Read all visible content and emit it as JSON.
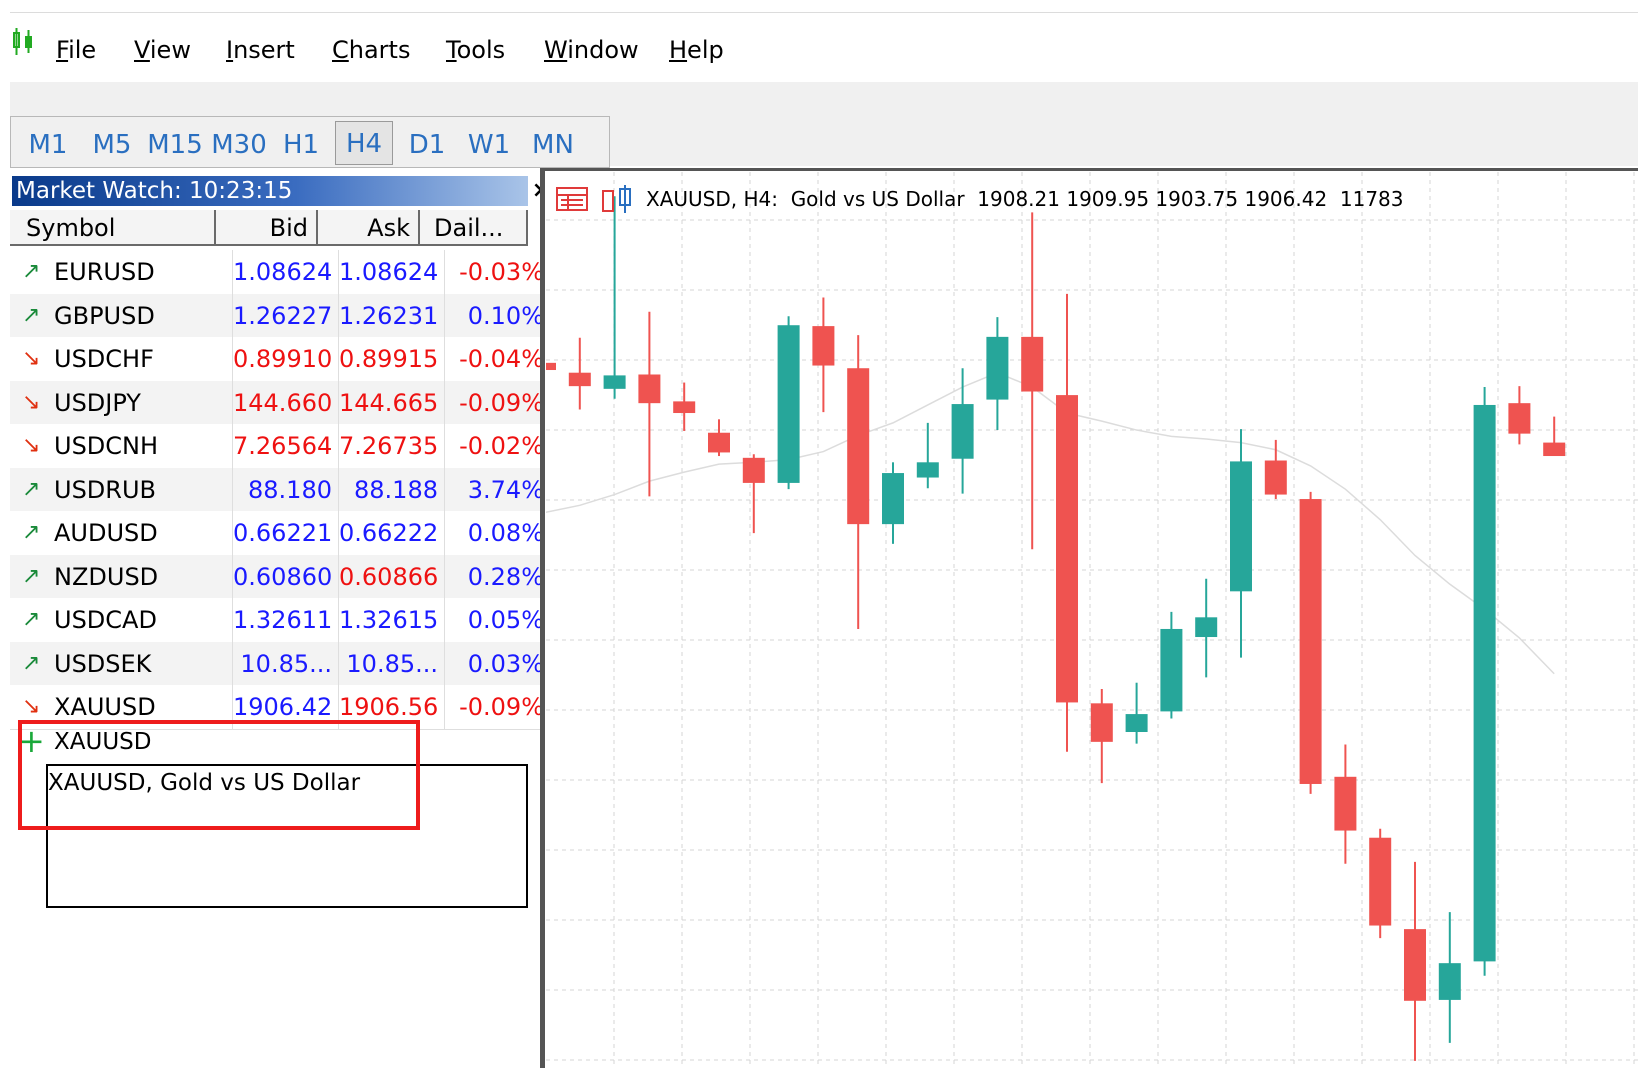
{
  "menu": {
    "items": [
      {
        "label": "File",
        "key": "F"
      },
      {
        "label": "View",
        "key": "V"
      },
      {
        "label": "Insert",
        "key": "I"
      },
      {
        "label": "Charts",
        "key": "C"
      },
      {
        "label": "Tools",
        "key": "T"
      },
      {
        "label": "Window",
        "key": "W"
      },
      {
        "label": "Help",
        "key": "H"
      }
    ]
  },
  "timeframes": [
    "M1",
    "M5",
    "M15",
    "M30",
    "H1",
    "H4",
    "D1",
    "W1",
    "MN"
  ],
  "active_timeframe": "H4",
  "market_watch": {
    "title": "Market Watch: 10:23:15",
    "close_label": "×",
    "columns": [
      "Symbol",
      "Bid",
      "Ask",
      "Dail..."
    ],
    "rows": [
      {
        "symbol": "EURUSD",
        "bid": "1.08624",
        "ask": "1.08624",
        "daily": "-0.03%",
        "dir": "up",
        "bid_color": "blue",
        "ask_color": "blue",
        "daily_color": "red"
      },
      {
        "symbol": "GBPUSD",
        "bid": "1.26227",
        "ask": "1.26231",
        "daily": "0.10%",
        "dir": "up",
        "bid_color": "blue",
        "ask_color": "blue",
        "daily_color": "blue"
      },
      {
        "symbol": "USDCHF",
        "bid": "0.89910",
        "ask": "0.89915",
        "daily": "-0.04%",
        "dir": "down",
        "bid_color": "red",
        "ask_color": "red",
        "daily_color": "red"
      },
      {
        "symbol": "USDJPY",
        "bid": "144.660",
        "ask": "144.665",
        "daily": "-0.09%",
        "dir": "down",
        "bid_color": "red",
        "ask_color": "red",
        "daily_color": "red"
      },
      {
        "symbol": "USDCNH",
        "bid": "7.26564",
        "ask": "7.26735",
        "daily": "-0.02%",
        "dir": "down",
        "bid_color": "red",
        "ask_color": "red",
        "daily_color": "red"
      },
      {
        "symbol": "USDRUB",
        "bid": "88.180",
        "ask": "88.188",
        "daily": "3.74%",
        "dir": "up",
        "bid_color": "blue",
        "ask_color": "blue",
        "daily_color": "blue"
      },
      {
        "symbol": "AUDUSD",
        "bid": "0.66221",
        "ask": "0.66222",
        "daily": "0.08%",
        "dir": "up",
        "bid_color": "blue",
        "ask_color": "blue",
        "daily_color": "blue"
      },
      {
        "symbol": "NZDUSD",
        "bid": "0.60860",
        "ask": "0.60866",
        "daily": "0.28%",
        "dir": "up",
        "bid_color": "blue",
        "ask_color": "red",
        "daily_color": "blue"
      },
      {
        "symbol": "USDCAD",
        "bid": "1.32611",
        "ask": "1.32615",
        "daily": "0.05%",
        "dir": "up",
        "bid_color": "blue",
        "ask_color": "blue",
        "daily_color": "blue"
      },
      {
        "symbol": "USDSEK",
        "bid": "10.85...",
        "ask": "10.85...",
        "daily": "0.03%",
        "dir": "up",
        "bid_color": "blue",
        "ask_color": "blue",
        "daily_color": "blue"
      },
      {
        "symbol": "XAUUSD",
        "bid": "1906.42",
        "ask": "1906.56",
        "daily": "-0.09%",
        "dir": "down",
        "bid_color": "blue",
        "ask_color": "red",
        "daily_color": "red"
      }
    ],
    "add_symbol": {
      "value": "XAUUSD",
      "suggestion": "XAUUSD, Gold vs US Dollar"
    }
  },
  "chart": {
    "title": "XAUUSD, H4:  Gold vs US Dollar  1908.21 1909.95 1903.75 1906.42  11783",
    "colors": {
      "bull": "#26a69a",
      "bear": "#ef5350",
      "grid": "#d4d4d4",
      "ma": "#dcdcdc"
    }
  },
  "chart_data": {
    "type": "candlestick",
    "title": "XAUUSD, H4:  Gold vs US Dollar  1908.21 1909.95 1903.75 1906.42  11783",
    "candles": [
      {
        "dir": "bear",
        "open": 0.787,
        "close": 0.779,
        "high": 0.787,
        "low": 0.779
      },
      {
        "dir": "bear",
        "open": 0.776,
        "close": 0.761,
        "high": 0.815,
        "low": 0.735
      },
      {
        "dir": "bull",
        "open": 0.758,
        "close": 0.773,
        "high": 0.973,
        "low": 0.747
      },
      {
        "dir": "bear",
        "open": 0.774,
        "close": 0.742,
        "high": 0.844,
        "low": 0.638
      },
      {
        "dir": "bear",
        "open": 0.744,
        "close": 0.731,
        "high": 0.765,
        "low": 0.711
      },
      {
        "dir": "bear",
        "open": 0.709,
        "close": 0.687,
        "high": 0.724,
        "low": 0.683
      },
      {
        "dir": "bear",
        "open": 0.681,
        "close": 0.653,
        "high": 0.685,
        "low": 0.597
      },
      {
        "dir": "bull",
        "open": 0.653,
        "close": 0.829,
        "high": 0.839,
        "low": 0.646
      },
      {
        "dir": "bear",
        "open": 0.828,
        "close": 0.784,
        "high": 0.86,
        "low": 0.732
      },
      {
        "dir": "bear",
        "open": 0.781,
        "close": 0.607,
        "high": 0.818,
        "low": 0.49
      },
      {
        "dir": "bull",
        "open": 0.607,
        "close": 0.664,
        "high": 0.676,
        "low": 0.585
      },
      {
        "dir": "bull",
        "open": 0.659,
        "close": 0.676,
        "high": 0.72,
        "low": 0.647
      },
      {
        "dir": "bull",
        "open": 0.68,
        "close": 0.741,
        "high": 0.781,
        "low": 0.641
      },
      {
        "dir": "bull",
        "open": 0.746,
        "close": 0.816,
        "high": 0.838,
        "low": 0.712
      },
      {
        "dir": "bear",
        "open": 0.816,
        "close": 0.755,
        "high": 0.955,
        "low": 0.579
      },
      {
        "dir": "bear",
        "open": 0.751,
        "close": 0.408,
        "high": 0.864,
        "low": 0.353
      },
      {
        "dir": "bear",
        "open": 0.407,
        "close": 0.364,
        "high": 0.423,
        "low": 0.318
      },
      {
        "dir": "bull",
        "open": 0.375,
        "close": 0.395,
        "high": 0.43,
        "low": 0.362
      },
      {
        "dir": "bull",
        "open": 0.398,
        "close": 0.49,
        "high": 0.509,
        "low": 0.39
      },
      {
        "dir": "bull",
        "open": 0.481,
        "close": 0.503,
        "high": 0.546,
        "low": 0.436
      },
      {
        "dir": "bull",
        "open": 0.532,
        "close": 0.677,
        "high": 0.713,
        "low": 0.458
      },
      {
        "dir": "bear",
        "open": 0.678,
        "close": 0.64,
        "high": 0.701,
        "low": 0.635
      },
      {
        "dir": "bear",
        "open": 0.635,
        "close": 0.317,
        "high": 0.643,
        "low": 0.306
      },
      {
        "dir": "bear",
        "open": 0.325,
        "close": 0.265,
        "high": 0.361,
        "low": 0.228
      },
      {
        "dir": "bear",
        "open": 0.257,
        "close": 0.159,
        "high": 0.267,
        "low": 0.145
      },
      {
        "dir": "bear",
        "open": 0.155,
        "close": 0.075,
        "high": 0.23,
        "low": 0.008
      },
      {
        "dir": "bull",
        "open": 0.076,
        "close": 0.117,
        "high": 0.174,
        "low": 0.028
      },
      {
        "dir": "bull",
        "open": 0.119,
        "close": 0.74,
        "high": 0.76,
        "low": 0.103
      },
      {
        "dir": "bear",
        "open": 0.742,
        "close": 0.708,
        "high": 0.761,
        "low": 0.696
      },
      {
        "dir": "bear",
        "open": 0.698,
        "close": 0.683,
        "high": 0.727,
        "low": 0.684
      }
    ],
    "ma": [
      0.62,
      0.628,
      0.64,
      0.655,
      0.665,
      0.674,
      0.676,
      0.679,
      0.688,
      0.706,
      0.72,
      0.74,
      0.76,
      0.776,
      0.76,
      0.731,
      0.722,
      0.712,
      0.705,
      0.702,
      0.698,
      0.69,
      0.672,
      0.646,
      0.612,
      0.572,
      0.54,
      0.512,
      0.48,
      0.44
    ],
    "grid": true
  }
}
